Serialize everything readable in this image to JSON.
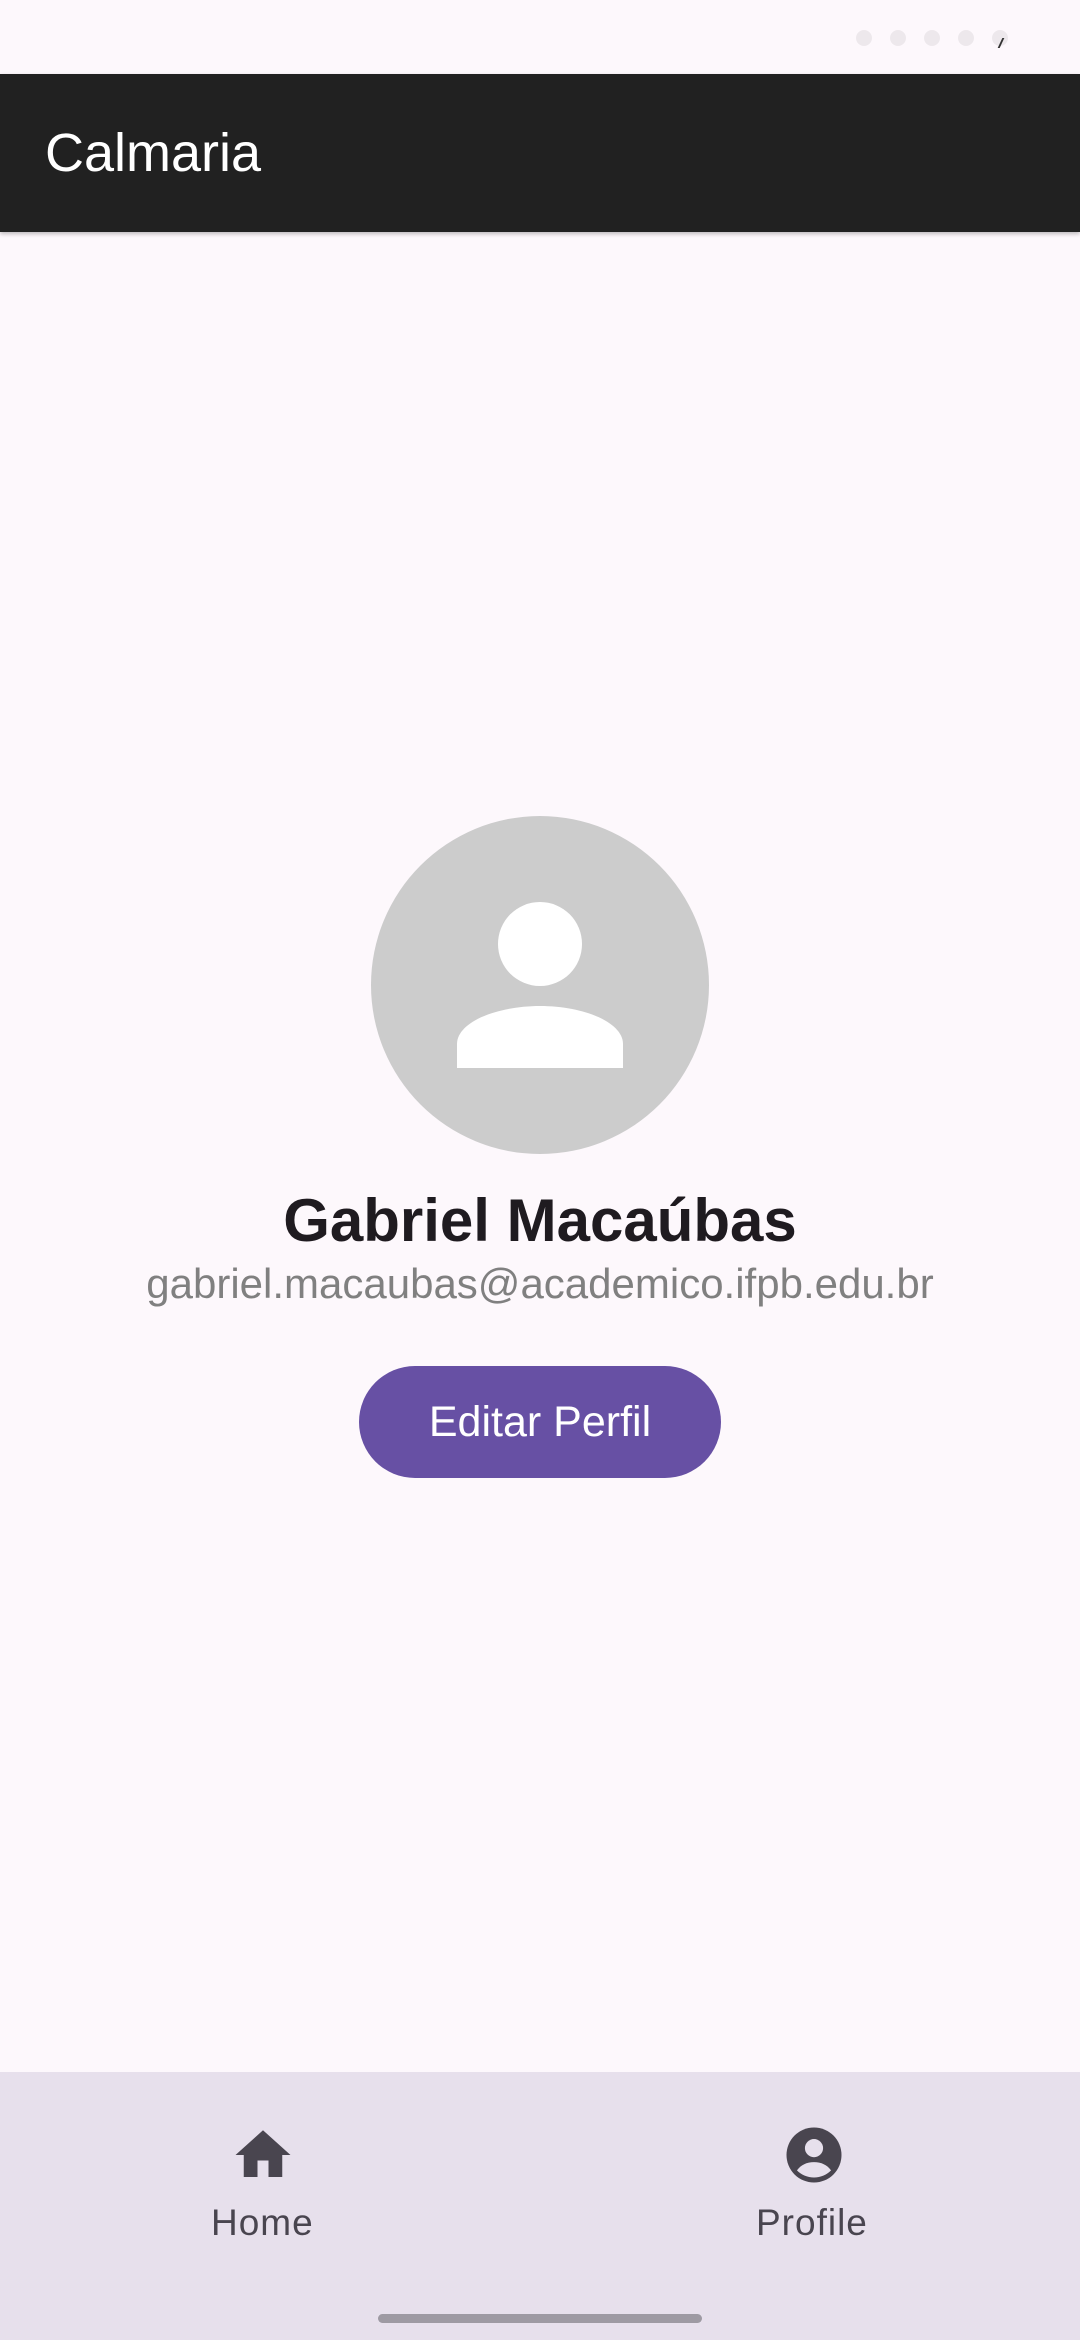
{
  "app_bar": {
    "title": "Calmaria"
  },
  "profile": {
    "avatar_icon": "person-icon",
    "name": "Gabriel Macaúbas",
    "email": "gabriel.macaubas@academico.ifpb.edu.br",
    "edit_button_label": "Editar Perfil"
  },
  "bottom_nav": {
    "items": [
      {
        "label": "Home",
        "icon": "home-icon"
      },
      {
        "label": "Profile",
        "icon": "account-circle-icon"
      }
    ]
  },
  "colors": {
    "app_bar": "#212121",
    "background": "#fdf8fc",
    "avatar": "#cccccc",
    "accent": "#6750a4",
    "bottom_nav": "#e7e0ec"
  }
}
